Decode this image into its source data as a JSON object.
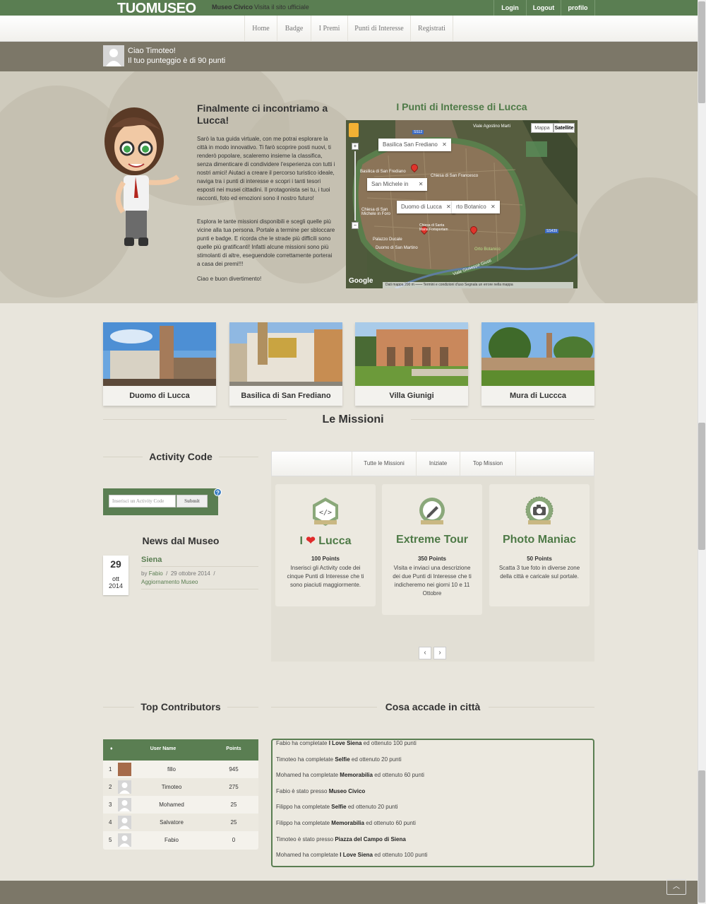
{
  "header": {
    "logo": "TUOMUSEO",
    "museum_name": "Museo Civico",
    "museum_sub": "Visita il sito ufficiale",
    "login": "Login",
    "logout": "Logout",
    "profile": "profilo"
  },
  "nav": [
    "Home",
    "Badge",
    "I Premi",
    "Punti di Interesse",
    "Registrati"
  ],
  "user": {
    "greeting": "Ciao Timoteo!",
    "score": "Il tuo punteggio è di 90 punti"
  },
  "guide": {
    "title": "Finalmente ci incontriamo a Lucca!",
    "p1": "Sarò la tua guida virtuale, con me potrai esplorare la città in modo innovativo. Ti farò scoprire posti nuovi, ti renderò popolare, scaleremo insieme la classifica, senza dimenticare di condividere l'esperienza con tutti i nostri amici! Aiutaci a creare il percorso turistico ideale, naviga tra i punti di interesse e scopri i tanti tesori esposti nei musei cittadini. Il protagonista sei tu, i tuoi racconti, foto ed emozioni sono il nostro futuro!",
    "p2": "Esplora le tante missioni disponibili e scegli quelle più vicine alla tua persona. Portale a termine per sbloccare punti e badge. E ricorda che le strade più difficili sono quelle più gratificanti! Infatti alcune missioni sono più stimolanti di altre, eseguendole correttamente porterai a casa dei premi!!!",
    "p3": "Ciao e buon divertimento!"
  },
  "map": {
    "title": "I Punti di Interesse di Lucca",
    "btn_map": "Mappa",
    "btn_sat": "Satellite",
    "bubbles": [
      "Basilica San Frediano",
      "San Michele in",
      "Duomo di Lucca",
      "rto Botanico"
    ],
    "google": "Google",
    "footer": "Dati mappa   200 m ⎯⎯⎯⎯   Termini e condizioni d'uso   Segnala un errore nella mappa",
    "labels": [
      "Viale Agostino Marti",
      "Basilica di San Frediano",
      "Chiesa di San Francesco",
      "Chiesa di San Michele in Foro",
      "Palazzo Ducale",
      "Duomo di San Martino",
      "Orto Botanico",
      "Viale Giuseppe Giusti",
      "Chiesa di Santa Maria Forisportam",
      "SS12",
      "SS439"
    ]
  },
  "poi": [
    {
      "label": "Duomo di Lucca"
    },
    {
      "label": "Basilica di San Frediano"
    },
    {
      "label": "Villa Giunigi"
    },
    {
      "label": "Mura di Luccca"
    }
  ],
  "missions_title": "Le Missioni",
  "activity": {
    "title": "Activity Code",
    "placeholder": "Inserisci un Activity Code",
    "submit": "Submit",
    "help": "?"
  },
  "news": {
    "title": "News dal Museo",
    "day": "29",
    "month": "ott",
    "year": "2014",
    "headline": "Siena",
    "by": "by",
    "author": "Fabio",
    "date": "29 ottobre 2014",
    "category": "Aggiornamento Museo"
  },
  "tabs": [
    "Tutte le Missioni",
    "Iniziate",
    "Top Mission"
  ],
  "missions": [
    {
      "name_pre": "I",
      "name_post": "Lucca",
      "points": "100 Points",
      "desc": "Inserisci gli Activity code dei cinque Punti di Interesse che ti sono piaciuti maggiormente.",
      "icon": "code-badge-icon"
    },
    {
      "name": "Extreme Tour",
      "points": "350 Points",
      "desc": "Visita e inviaci una descrizione dei due Punti di Interesse che ti indicheremo nei giorni 10 e 11 Ottobre",
      "icon": "pencil-badge-icon"
    },
    {
      "name": "Photo Maniac",
      "points": "50 Points",
      "desc": "Scatta 3 tue foto in diverse zone della città e caricale sul portale.",
      "icon": "camera-badge-icon"
    }
  ],
  "contributors": {
    "title": "Top Contributors",
    "col_sort": "♦",
    "col_user": "User Name",
    "col_points": "Points",
    "rows": [
      {
        "n": "1",
        "user": "fillo",
        "points": "945"
      },
      {
        "n": "2",
        "user": "Timoteo",
        "points": "275"
      },
      {
        "n": "3",
        "user": "Mohamed",
        "points": "25"
      },
      {
        "n": "4",
        "user": "Salvatore",
        "points": "25"
      },
      {
        "n": "5",
        "user": "Fabio",
        "points": "0"
      }
    ]
  },
  "feed": {
    "title": "Cosa accade in città",
    "items": [
      {
        "pre": "Fabio ha completate",
        "bold": "I Love Siena",
        "post": "ed ottenuto 100 punti"
      },
      {
        "pre": "Timoteo ha completate",
        "bold": "Selfie",
        "post": "ed ottenuto 20 punti"
      },
      {
        "pre": "Mohamed ha completate",
        "bold": "Memorabilia",
        "post": "ed ottenuto 60 punti"
      },
      {
        "pre": "Fabio è stato presso",
        "bold": "Museo Civico",
        "post": ""
      },
      {
        "pre": "Filippo ha completate",
        "bold": "Selfie",
        "post": "ed ottenuto 20 punti"
      },
      {
        "pre": "Filippo ha completate",
        "bold": "Memorabilia",
        "post": "ed ottenuto 60 punti"
      },
      {
        "pre": "Timoteo è stato presso",
        "bold": "Piazza del Campo di Siena",
        "post": ""
      },
      {
        "pre": "Mohamed ha completate",
        "bold": "I Love Siena",
        "post": "ed ottenuto 100 punti"
      }
    ]
  },
  "colors": {
    "accent": "#5a7e52",
    "bar": "#7c7768",
    "bg": "#e8e5dc"
  }
}
